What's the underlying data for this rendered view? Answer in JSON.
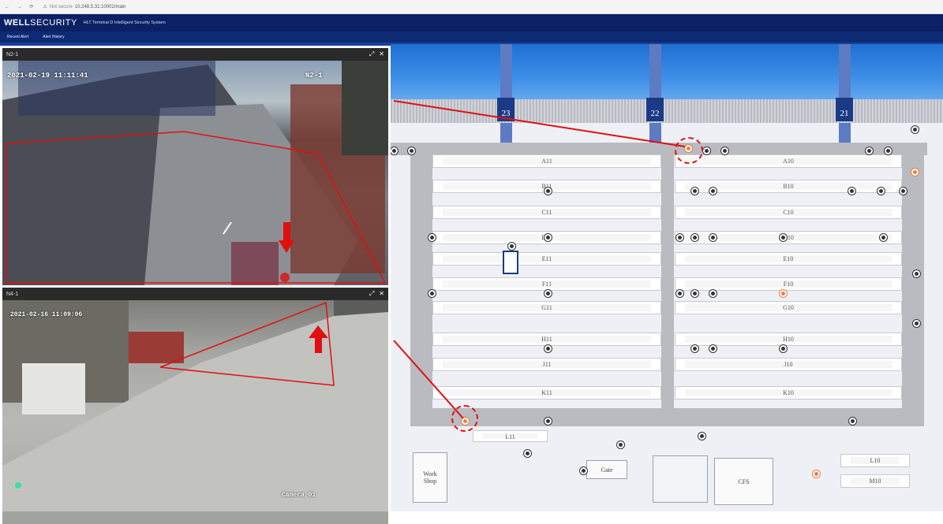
{
  "browser": {
    "security_text": "Not secure",
    "url": "10.248.5.31:10002/main"
  },
  "app": {
    "logo_bold": "WELL",
    "logo_rest": "SECURITY",
    "system_name": "HLT Terminal D Intelligent Security System"
  },
  "menu": [
    {
      "label": "Recent Alert"
    },
    {
      "label": "Alert History"
    }
  ],
  "cameras": [
    {
      "name": "N2-1",
      "osd_time": "2021-02-19 11:11:41",
      "osd_name": "N2-1"
    },
    {
      "name": "N4-1",
      "osd_time": "2021-02-16 11:09:06",
      "osd_name": "Camera 01"
    }
  ],
  "map": {
    "cranes": [
      "23",
      "22",
      "21"
    ],
    "blocks_left": [
      "A11",
      "B11",
      "C11",
      "D11",
      "E11",
      "F11",
      "G11",
      "H11",
      "J11",
      "K11"
    ],
    "blocks_right": [
      "A10",
      "B10",
      "C10",
      "D10",
      "E10",
      "F10",
      "G10",
      "H10",
      "J10",
      "K10"
    ],
    "block_l11": "L11",
    "block_l10": "L10",
    "block_m10": "M10",
    "workshop": "Work\nShop",
    "gate": "Gate",
    "cfs": "CFS"
  },
  "colors": {
    "header": "#0b2163",
    "alert": "#f07b3b",
    "zone": "#e01010",
    "sea": "#1e6fd2"
  }
}
